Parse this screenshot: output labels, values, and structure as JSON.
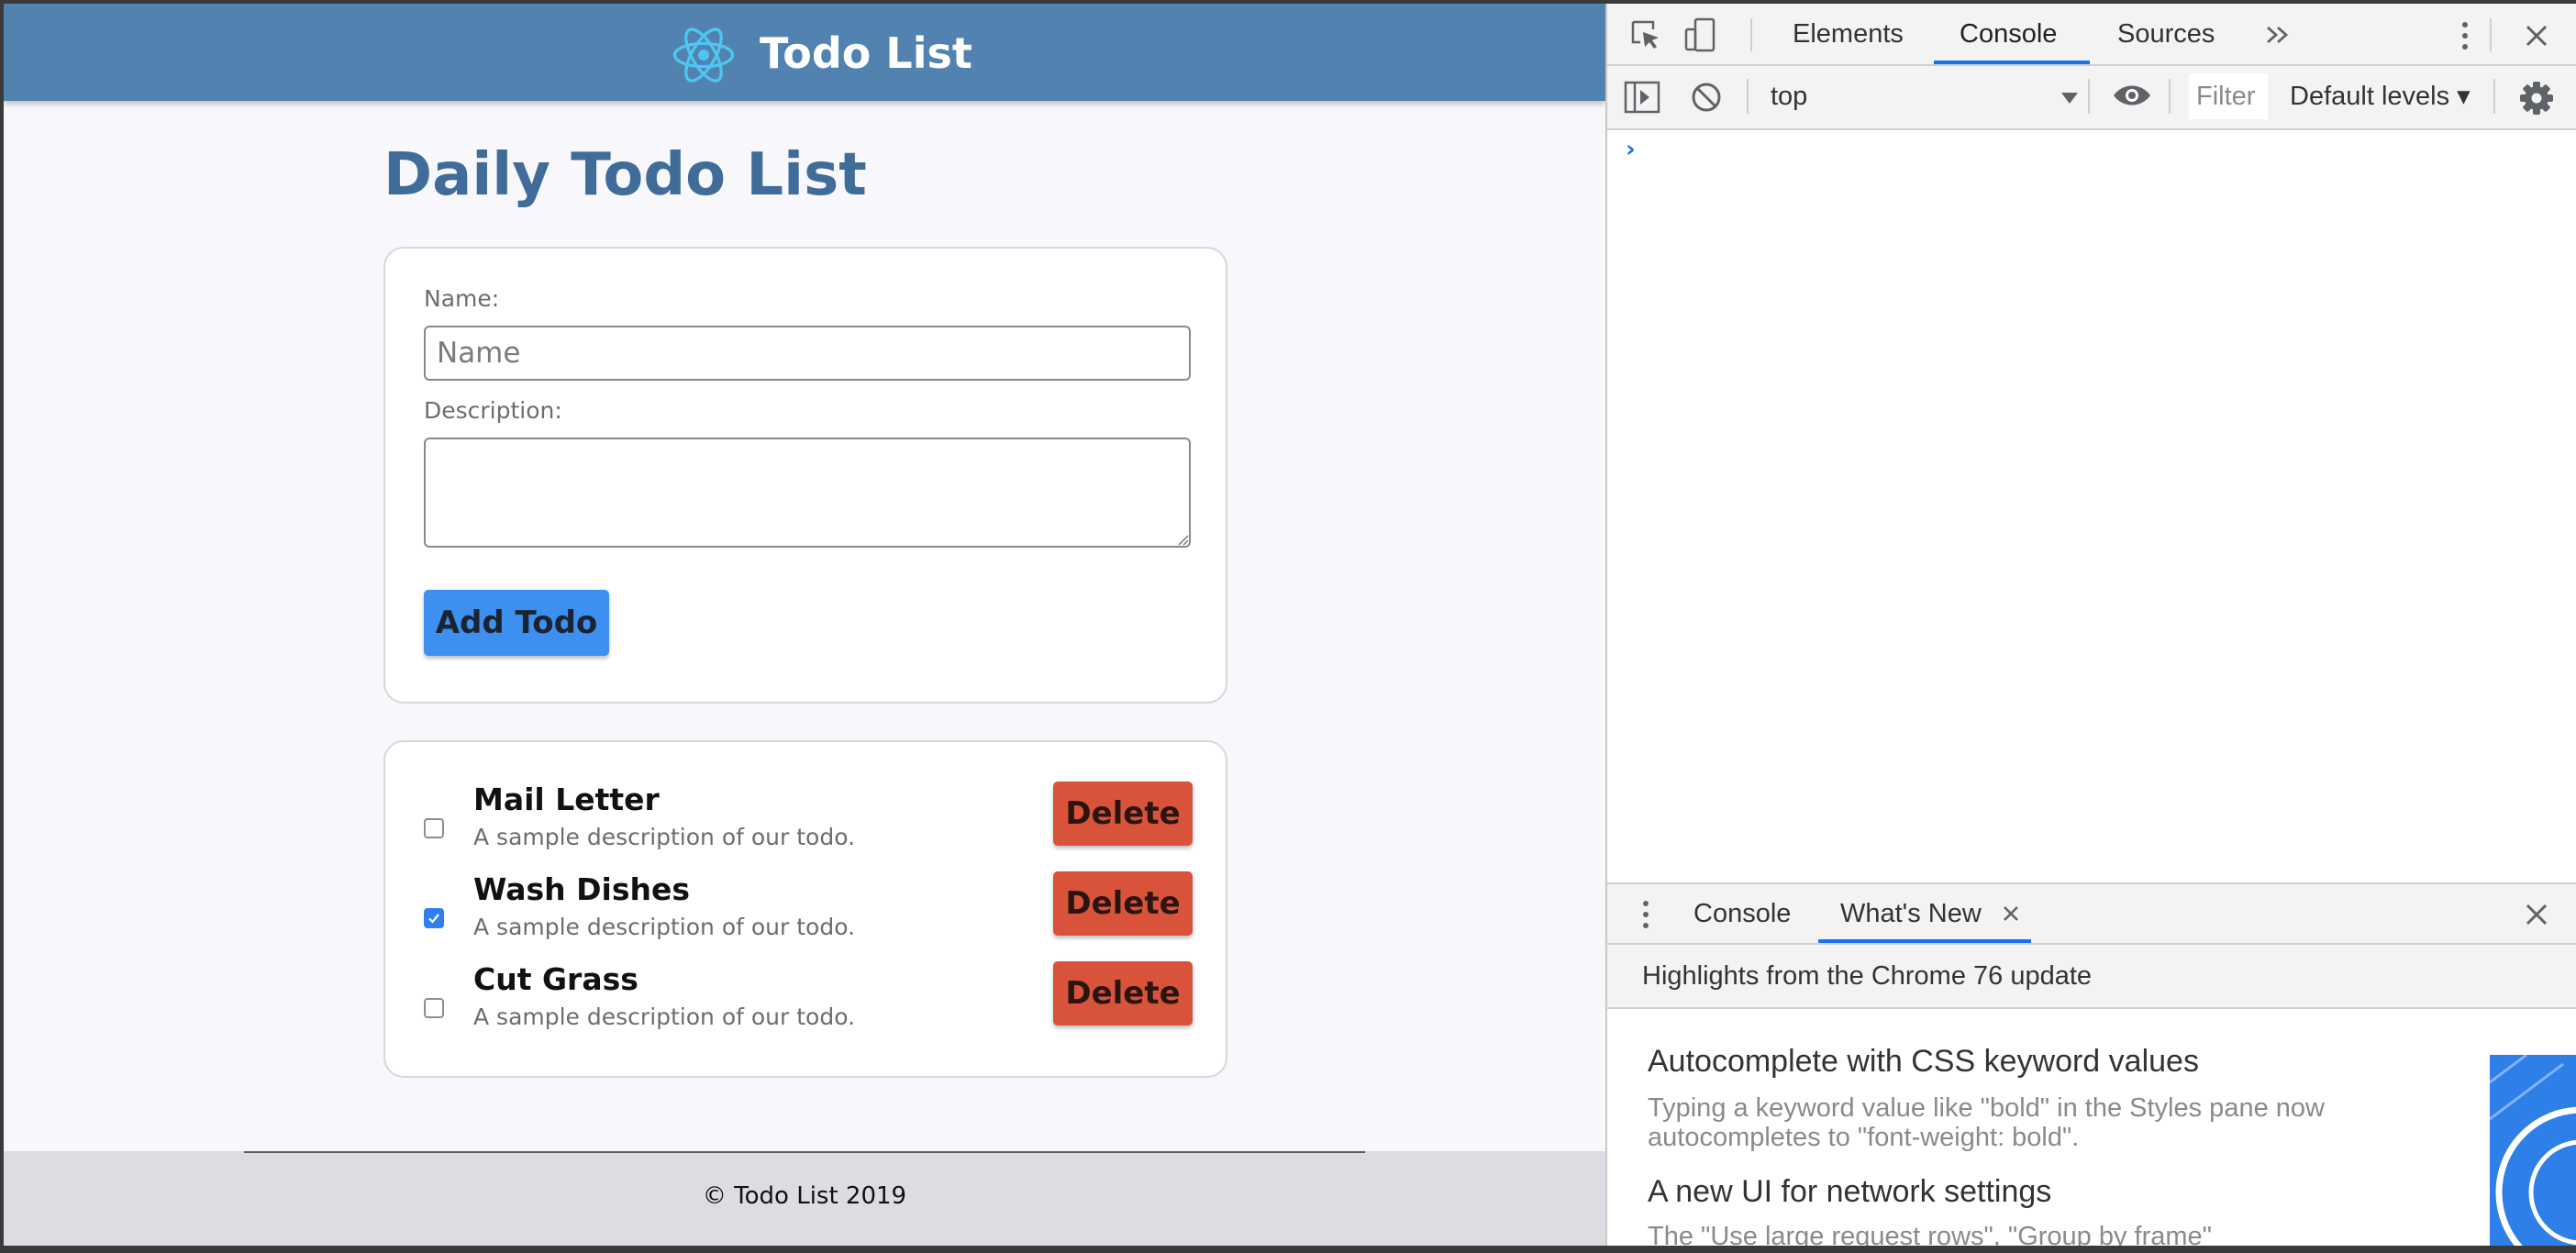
{
  "app": {
    "brand": "Todo List",
    "page_title": "Daily Todo List",
    "form": {
      "name_label": "Name:",
      "name_placeholder": "Name",
      "name_value": "",
      "description_label": "Description:",
      "description_value": "",
      "add_button": "Add Todo"
    },
    "todos": [
      {
        "name": "Mail Letter",
        "description": "A sample description of our todo.",
        "done": false,
        "delete_label": "Delete"
      },
      {
        "name": "Wash Dishes",
        "description": "A sample description of our todo.",
        "done": true,
        "delete_label": "Delete"
      },
      {
        "name": "Cut Grass",
        "description": "A sample description of our todo.",
        "done": false,
        "delete_label": "Delete"
      }
    ],
    "footer": "© Todo List 2019",
    "colors": {
      "header": "#5282b0",
      "title": "#3f6c99",
      "add_button": "#3d8ff0",
      "delete_button": "#d9533b",
      "checkbox_checked": "#2f7ff0"
    }
  },
  "devtools": {
    "tabs": [
      "Elements",
      "Console",
      "Sources"
    ],
    "active_tab": "Console",
    "more_tabs_icon": "double-chevron-right-icon",
    "context": "top",
    "filter_placeholder": "Filter",
    "levels": "Default levels ▾",
    "prompt": "›",
    "drawer": {
      "tabs": [
        "Console",
        "What's New"
      ],
      "active_tab": "What's New",
      "highlights": "Highlights from the Chrome 76 update",
      "items": [
        {
          "title": "Autocomplete with CSS keyword values",
          "description": "Typing a keyword value like \"bold\" in the Styles pane now autocompletes to \"font-weight: bold\"."
        },
        {
          "title": "A new UI for network settings",
          "description": "The \"Use large request rows\", \"Group by frame\""
        }
      ]
    },
    "accent": "#1a73e8"
  }
}
